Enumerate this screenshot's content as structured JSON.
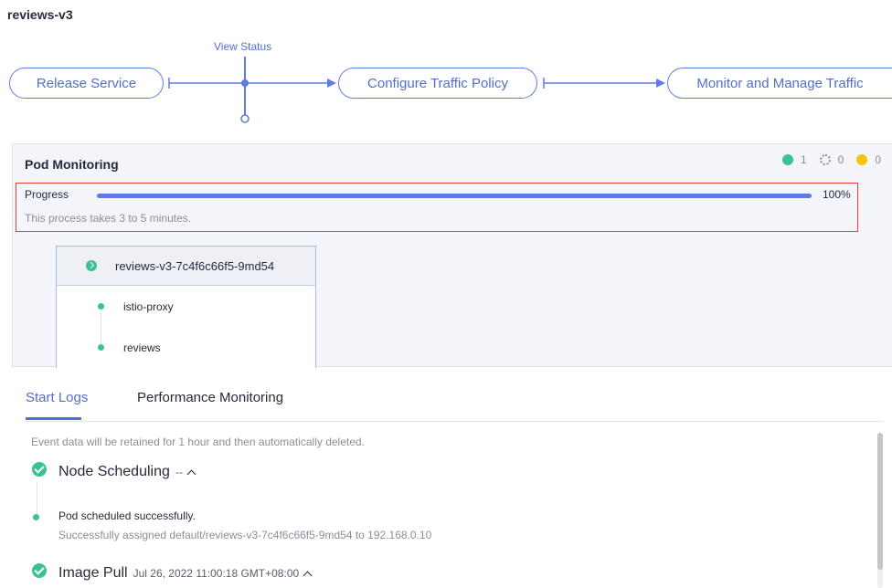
{
  "page": {
    "title": "reviews-v3"
  },
  "flow": {
    "steps": [
      {
        "label": "Release Service"
      },
      {
        "label": "Configure Traffic Policy"
      },
      {
        "label": "Monitor and Manage Traffic"
      }
    ],
    "view_status_label": "View Status"
  },
  "pod_monitoring": {
    "title": "Pod Monitoring",
    "status_counts": {
      "running": "1",
      "pending": "0",
      "warning": "0"
    },
    "progress": {
      "label": "Progress",
      "percent": 100,
      "percent_text": "100%",
      "note": "This process takes 3 to 5 minutes."
    },
    "pod": {
      "name": "reviews-v3-7c4f6c66f5-9md54",
      "containers": [
        {
          "name": "istio-proxy"
        },
        {
          "name": "reviews"
        }
      ]
    }
  },
  "tabs": [
    {
      "label": "Start Logs"
    },
    {
      "label": "Performance Monitoring"
    }
  ],
  "logs": {
    "retention_note": "Event data will be retained for 1 hour and then automatically deleted.",
    "events": [
      {
        "title": "Node Scheduling",
        "meta": "--",
        "sub": {
          "message": "Pod scheduled successfully.",
          "detail": "Successfully assigned default/reviews-v3-7c4f6c66f5-9md54 to 192.168.0.10"
        }
      },
      {
        "title": "Image Pull",
        "meta": "Jul 26, 2022 11:00:18 GMT+08:00"
      }
    ]
  },
  "colors": {
    "accent": "#526ecc",
    "success": "#3ac295",
    "warning": "#fac20a",
    "highlight_border": "#e9412e"
  },
  "icons": [
    "arrow-right-circle-icon",
    "pending-spinner-icon",
    "warning-circle-icon",
    "check-circle-icon",
    "caret-up-icon"
  ]
}
